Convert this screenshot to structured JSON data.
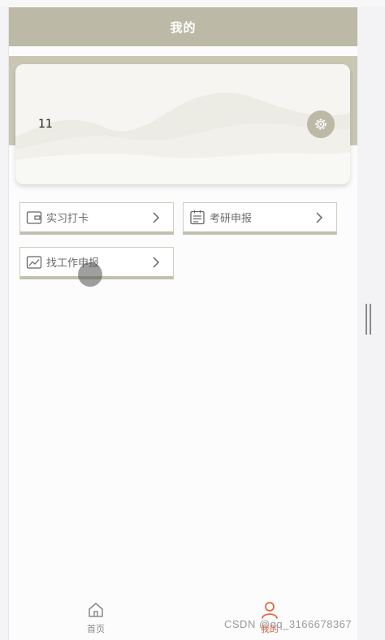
{
  "navbar": {
    "title": "我的"
  },
  "profile": {
    "name": "11",
    "settings_icon": "gear-icon"
  },
  "menu": [
    {
      "label": "实习打卡",
      "icon": "wallet-icon"
    },
    {
      "label": "考研申报",
      "icon": "calendar-icon"
    },
    {
      "label": "找工作申报",
      "icon": "chart-image-icon"
    }
  ],
  "tabbar": {
    "tabs": [
      {
        "label": "首页",
        "icon": "home-icon",
        "active": false
      },
      {
        "label": "我的",
        "icon": "user-icon",
        "active": true
      }
    ]
  },
  "watermark": "CSDN @qq_3166678367",
  "colors": {
    "primary": "#bcbaa6",
    "active_tab": "#e0643f",
    "inactive_tab": "#8a8a8a"
  }
}
